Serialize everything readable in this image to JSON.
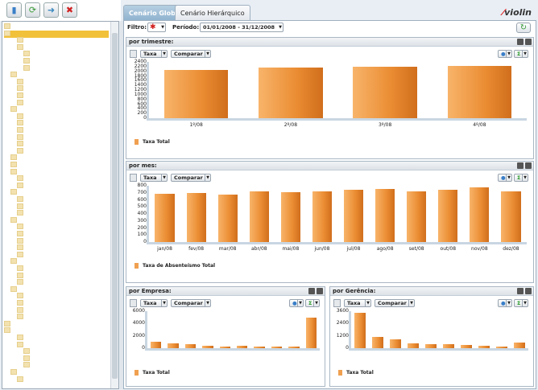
{
  "toolbar": {
    "icons": [
      "chart-icon",
      "refresh-icon",
      "link-icon",
      "delete-icon"
    ]
  },
  "tabs": [
    {
      "label": "Cenário Global"
    },
    {
      "label": "Cenário Hierárquico"
    }
  ],
  "brand": "violin",
  "filter": {
    "label": "Filtro:",
    "period_label": "Período:",
    "period_value": "01/01/2008 - 31/12/2008"
  },
  "panel_ctrl": {
    "rate": "Taxa",
    "compare": "Comparar"
  },
  "colors": {
    "accent": "#f2c13a",
    "bar": "#ea8c32"
  },
  "chart_data": [
    {
      "type": "bar",
      "title": "por trimestre:",
      "categories": [
        "1º/08",
        "2º/08",
        "3º/08",
        "4º/08"
      ],
      "values": [
        2050,
        2150,
        2190,
        2220
      ],
      "yticks": [
        "2400",
        "2200",
        "2000",
        "1800",
        "1600",
        "1400",
        "1200",
        "1000",
        "800",
        "600",
        "400",
        "200",
        "0"
      ],
      "ylim": [
        0,
        2400
      ],
      "legend": "Taxa Total"
    },
    {
      "type": "bar",
      "title": "por mes:",
      "categories": [
        "jan/08",
        "fev/08",
        "mar/08",
        "abr/08",
        "mai/08",
        "jun/08",
        "jul/08",
        "ago/08",
        "set/08",
        "out/08",
        "nov/08",
        "dez/08"
      ],
      "values": [
        690,
        700,
        670,
        720,
        710,
        720,
        740,
        760,
        720,
        745,
        780,
        720
      ],
      "yticks": [
        "800",
        "700",
        "600",
        "500",
        "400",
        "300",
        "200",
        "100",
        "0"
      ],
      "ylim": [
        0,
        800
      ],
      "legend": "Taxa de Absenteísmo Total"
    },
    {
      "type": "bar",
      "title": "por Empresa:",
      "categories": [
        "",
        "",
        "",
        "",
        "",
        "",
        "",
        "",
        "",
        ""
      ],
      "values": [
        1100,
        800,
        700,
        400,
        300,
        400,
        300,
        300,
        300,
        5000
      ],
      "yticks": [
        "6000",
        "4000",
        "2000",
        "0"
      ],
      "ylim": [
        0,
        6000
      ],
      "legend": "Taxa Total"
    },
    {
      "type": "bar",
      "title": "por Gerência:",
      "categories": [
        "",
        "",
        "",
        "",
        "",
        "",
        "",
        "",
        "",
        ""
      ],
      "values": [
        3800,
        1200,
        1000,
        500,
        450,
        400,
        350,
        300,
        200,
        600
      ],
      "yticks": [
        "3600",
        "2400",
        "1200",
        "0"
      ],
      "ylim": [
        0,
        4000
      ],
      "legend": "Taxa Total"
    }
  ]
}
